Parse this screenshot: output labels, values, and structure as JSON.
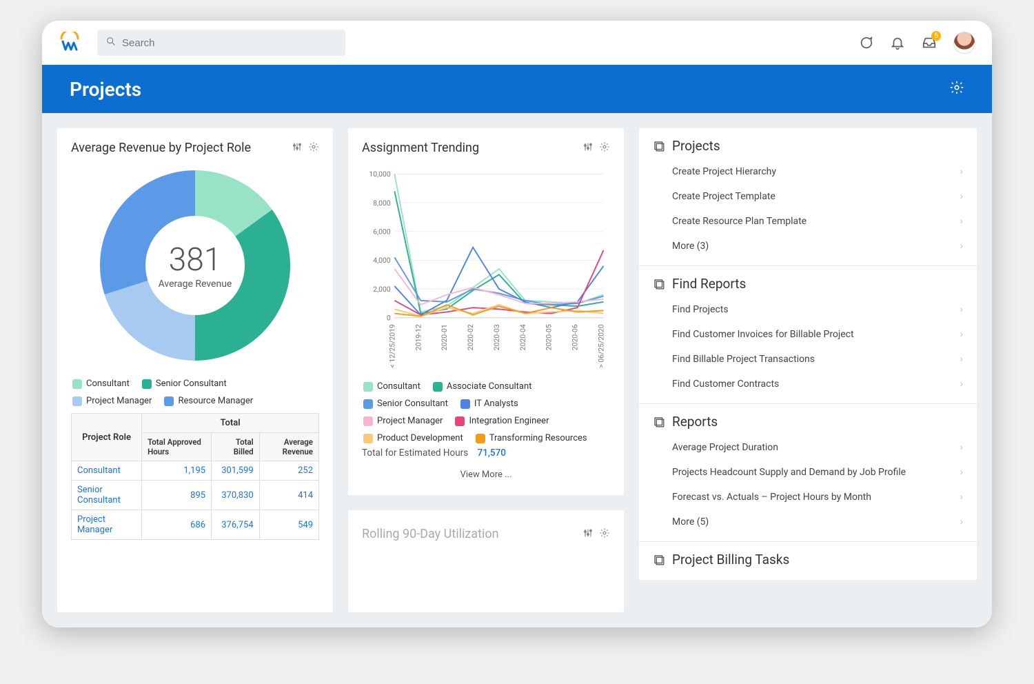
{
  "search": {
    "placeholder": "Search"
  },
  "header": {
    "inbox_badge": "5"
  },
  "page_title": "Projects",
  "card_revenue": {
    "title": "Average Revenue by Project Role",
    "center_value": "381",
    "center_label": "Average Revenue",
    "legend": [
      "Consultant",
      "Senior Consultant",
      "Project Manager",
      "Resource Manager"
    ],
    "table": {
      "group_header": "Total",
      "columns": [
        "Project Role",
        "Total Approved Hours",
        "Total Billed",
        "Average Revenue"
      ],
      "rows": [
        {
          "role": "Consultant",
          "hours": "1,195",
          "billed": "301,599",
          "avg": "252"
        },
        {
          "role": "Senior Consultant",
          "hours": "895",
          "billed": "370,830",
          "avg": "414"
        },
        {
          "role": "Project Manager",
          "hours": "686",
          "billed": "376,754",
          "avg": "549"
        }
      ]
    }
  },
  "card_trending": {
    "title": "Assignment Trending",
    "y_ticks": [
      "10,000",
      "8,000",
      "6,000",
      "4,000",
      "2,000",
      "0"
    ],
    "x_ticks": [
      "< 12/25/2019",
      "2019-12",
      "2020-01",
      "2020-02",
      "2020-03",
      "2020-04",
      "2020-05",
      "2020-06",
      "> 06/25/2020"
    ],
    "legend": [
      "Consultant",
      "Associate Consultant",
      "Senior Consultant",
      "IT Analysts",
      "Project Manager",
      "Integration Engineer",
      "Product Development",
      "Transforming Resources"
    ],
    "total_label": "Total for Estimated Hours",
    "total_value": "71,570",
    "view_more": "View More ..."
  },
  "card_stub": {
    "title": "Rolling 90-Day Utilization"
  },
  "side": {
    "sections": [
      {
        "title": "Projects",
        "items": [
          "Create Project Hierarchy",
          "Create Project Template",
          "Create Resource Plan Template",
          "More (3)"
        ]
      },
      {
        "title": "Find Reports",
        "items": [
          "Find Projects",
          "Find Customer Invoices for Billable Project",
          "Find Billable Project Transactions",
          "Find Customer Contracts"
        ]
      },
      {
        "title": "Reports",
        "items": [
          "Average Project Duration",
          "Projects Headcount Supply and Demand by Job Profile",
          "Forecast vs. Actuals – Project Hours by Month",
          "More (5)"
        ]
      },
      {
        "title": "Project Billing Tasks",
        "items": []
      }
    ]
  },
  "colors": {
    "consultant": "#98e2c6",
    "senior_consultant": "#2bb091",
    "project_manager": "#a8c9f0",
    "resource_manager": "#5c99e6",
    "associate_consultant": "#2bb091",
    "it_analysts": "#4b84e6",
    "pm_pink": "#f6b6cf",
    "integration": "#e6447a",
    "product_dev": "#f8c97a",
    "transforming": "#f59b1a"
  },
  "chart_data": [
    {
      "type": "pie",
      "title": "Average Revenue by Project Role",
      "series": [
        {
          "name": "Consultant",
          "value": 15
        },
        {
          "name": "Senior Consultant",
          "value": 35
        },
        {
          "name": "Project Manager",
          "value": 20
        },
        {
          "name": "Resource Manager",
          "value": 30
        }
      ],
      "center_stat": {
        "label": "Average Revenue",
        "value": 381
      }
    },
    {
      "type": "line",
      "title": "Assignment Trending",
      "xlabel": "",
      "ylabel": "",
      "ylim": [
        0,
        10000
      ],
      "categories": [
        "< 12/25/2019",
        "2019-12",
        "2020-01",
        "2020-02",
        "2020-03",
        "2020-04",
        "2020-05",
        "2020-06",
        "> 06/25/2020"
      ],
      "series": [
        {
          "name": "Consultant",
          "values": [
            10000,
            400,
            800,
            2100,
            3400,
            1200,
            1100,
            1000,
            1600
          ]
        },
        {
          "name": "Associate Consultant",
          "values": [
            8800,
            300,
            600,
            1900,
            3000,
            1000,
            900,
            800,
            1100
          ]
        },
        {
          "name": "Senior Consultant",
          "values": [
            4200,
            1200,
            1100,
            2000,
            1700,
            1200,
            900,
            1000,
            1500
          ]
        },
        {
          "name": "IT Analysts",
          "values": [
            2200,
            200,
            1200,
            4900,
            2000,
            1100,
            700,
            1100,
            3600
          ]
        },
        {
          "name": "Project Manager",
          "values": [
            3400,
            900,
            1600,
            2100,
            1600,
            1000,
            1000,
            1100,
            1300
          ]
        },
        {
          "name": "Integration Engineer",
          "values": [
            1200,
            200,
            400,
            700,
            600,
            400,
            300,
            700,
            4700
          ]
        },
        {
          "name": "Product Development",
          "values": [
            600,
            100,
            700,
            300,
            900,
            300,
            400,
            500,
            300
          ]
        },
        {
          "name": "Transforming Resources",
          "values": [
            300,
            100,
            900,
            200,
            800,
            300,
            700,
            400,
            500
          ]
        }
      ],
      "total": {
        "label": "Total for Estimated Hours",
        "value": 71570
      }
    },
    {
      "type": "table",
      "title": "Average Revenue by Project Role",
      "columns": [
        "Project Role",
        "Total Approved Hours",
        "Total Billed",
        "Average Revenue"
      ],
      "rows": [
        [
          "Consultant",
          1195,
          301599,
          252
        ],
        [
          "Senior Consultant",
          895,
          370830,
          414
        ],
        [
          "Project Manager",
          686,
          376754,
          549
        ]
      ]
    }
  ]
}
